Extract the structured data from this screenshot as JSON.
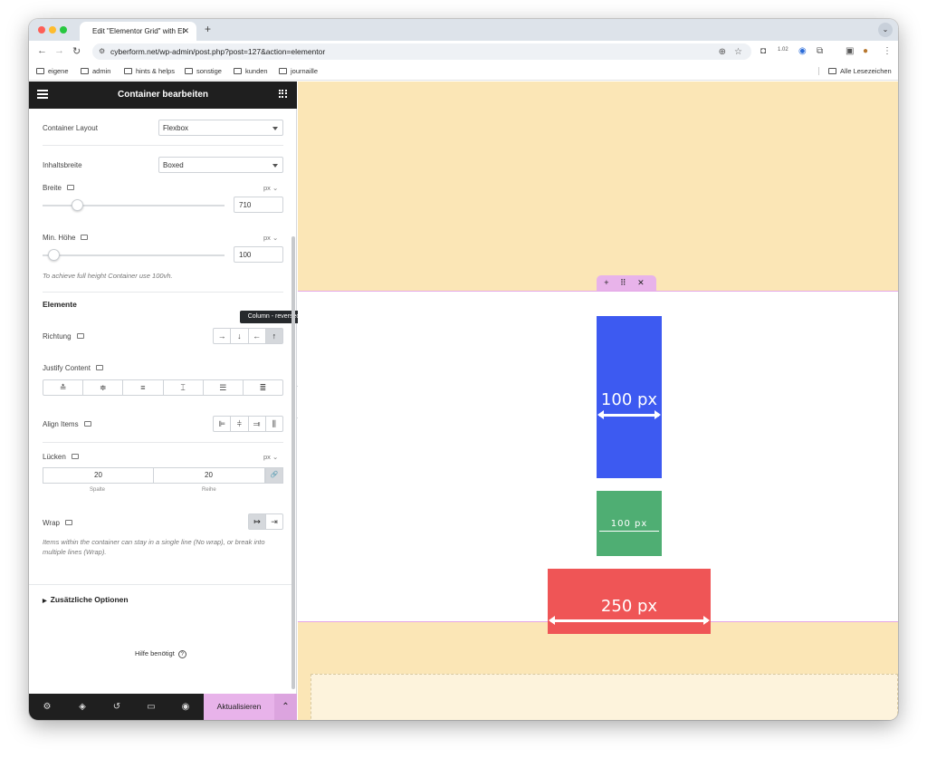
{
  "browser": {
    "tab_title": "Edit \"Elementor Grid\" with El",
    "tab_close": "✕",
    "new_tab": "+",
    "url": "cyberform.net/wp-admin/post.php?post=127&action=elementor",
    "badge": "1.02",
    "bookmarks": [
      "eigene",
      "admin",
      "hints & helps",
      "sonstige",
      "kunden",
      "journaille"
    ],
    "all_bookmarks": "Alle Lesezeichen"
  },
  "panel": {
    "title": "Container bearbeiten",
    "container_layout": {
      "label": "Container Layout",
      "value": "Flexbox"
    },
    "content_width": {
      "label": "Inhaltsbreite",
      "value": "Boxed"
    },
    "width": {
      "label": "Breite",
      "unit": "px ⌄",
      "value": "710",
      "slider_fraction": 0.19
    },
    "min_height": {
      "label": "Min. Höhe",
      "unit": "px ⌄",
      "value": "100",
      "slider_fraction": 0.06,
      "hint": "To achieve full height Container use 100vh."
    },
    "elements_title": "Elemente",
    "direction": {
      "label": "Richtung",
      "buttons": [
        "→",
        "↓",
        "←",
        "↑"
      ],
      "active_index": 3,
      "tooltip": "Column - reversed"
    },
    "justify_content": {
      "label": "Justify Content",
      "buttons": [
        "≛",
        "≑",
        "≡",
        "⌶",
        "☰",
        "≣"
      ]
    },
    "align_items": {
      "label": "Align Items",
      "buttons": [
        "⊫",
        "⫩",
        "⫥",
        "⫼"
      ]
    },
    "gaps": {
      "label": "Lücken",
      "unit": "px ⌄",
      "column": "20",
      "row": "20",
      "column_label": "Spalte",
      "row_label": "Reihe",
      "link_icon": "🔗"
    },
    "wrap": {
      "label": "Wrap",
      "buttons": [
        "↦",
        "⇥"
      ],
      "hint": "Items within the container can stay in a single line (No wrap), or break into multiple lines (Wrap)."
    },
    "additional_options": "Zusätzliche Optionen",
    "help": "Hilfe benötigt",
    "update_button": "Aktualisieren",
    "update_arrow": "⌃"
  },
  "canvas": {
    "handle_icons": "+ ⠿ ✕",
    "blue_label": "100 px",
    "green_label": "100 px",
    "red_label": "250 px",
    "add_icon": "+",
    "folder_icon": "■"
  },
  "colors": {
    "blue": "#3d5af1",
    "green": "#4fae73",
    "red": "#ef5556",
    "canvas_bg": "#fbe6b6",
    "accent": "#e8b3ea"
  }
}
